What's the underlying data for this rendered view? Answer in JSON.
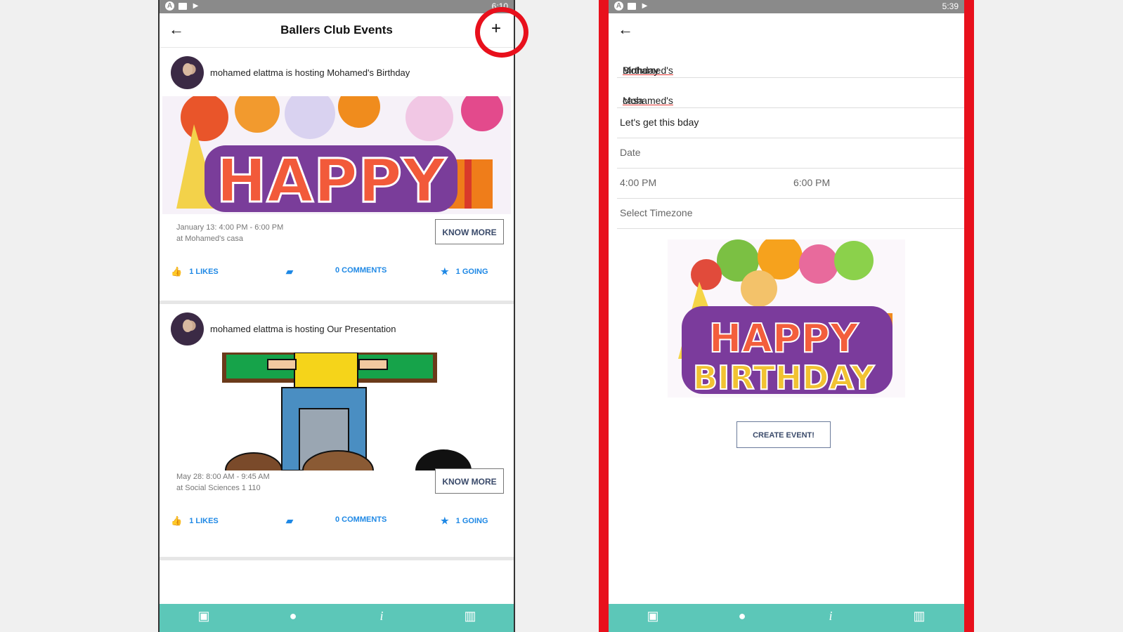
{
  "left": {
    "status_time": "6:10",
    "title": "Ballers Club Events",
    "add_icon": "plus-icon",
    "events": [
      {
        "host_text": "mohamed elattma is hosting Mohamed's Birthday",
        "date": "January 13: 4:00 PM - 6:00 PM",
        "location": "at Mohamed's casa",
        "know_more": "KNOW MORE",
        "likes": "1 LIKES",
        "comments": "0 COMMENTS",
        "going": "1 GOING",
        "image_text": "HAPPY"
      },
      {
        "host_text": "mohamed elattma is hosting Our Presentation",
        "date": "May 28: 8:00 AM - 9:45 AM",
        "location": "at Social Sciences 1 110",
        "know_more": "KNOW MORE",
        "likes": "1 LIKES",
        "comments": "0 COMMENTS",
        "going": "1 GOING"
      }
    ]
  },
  "right": {
    "status_time": "5:39",
    "fields": {
      "name_a": "Mohamed's",
      "name_b": " Birthday",
      "loc_a": "Mohamed's",
      "loc_b": " casa",
      "description": "Let's get this bday",
      "date_placeholder": "Date",
      "start_time": "4:00 PM",
      "end_time": "6:00 PM",
      "timezone_placeholder": "Select Timezone"
    },
    "image_text_1": "HAPPY",
    "image_text_2": "BIRTHDAY",
    "create_button": "CREATE EVENT!"
  },
  "nav_icons": [
    "calendar-icon",
    "chat-icon",
    "info-icon",
    "bar-chart-icon"
  ],
  "colors": {
    "accent": "#5cc7b8",
    "link": "#1e88e5",
    "highlight": "#e8101c"
  }
}
